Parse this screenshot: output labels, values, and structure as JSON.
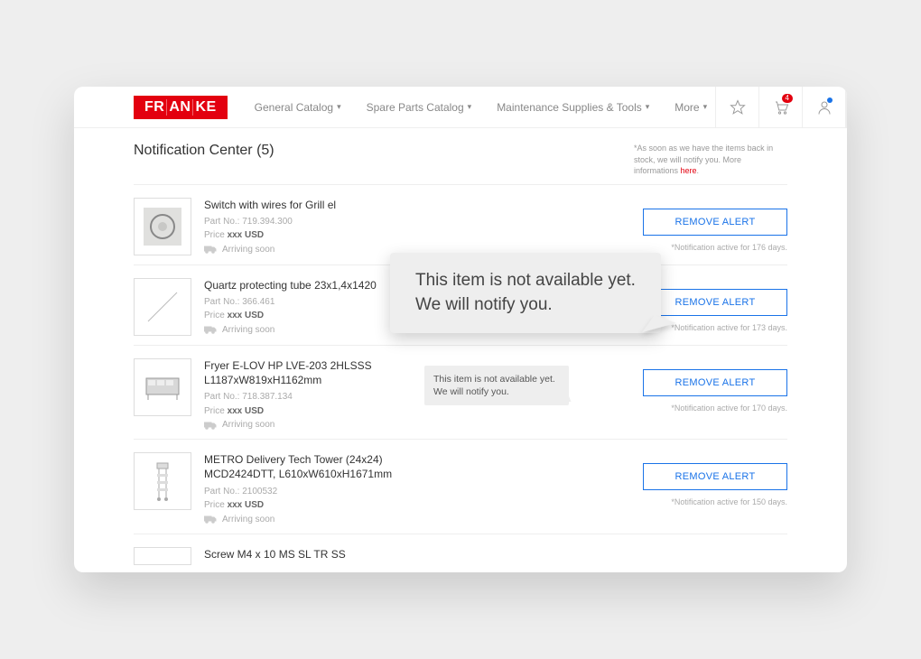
{
  "brand": "FRANKE",
  "nav": {
    "items": [
      {
        "label": "General Catalog"
      },
      {
        "label": "Spare Parts Catalog"
      },
      {
        "label": "Maintenance Supplies & Tools"
      },
      {
        "label": "More"
      }
    ],
    "cart_badge": "4"
  },
  "page": {
    "title": "Notification Center (5)",
    "info_prefix": "*As soon as we have the items back in stock, we will notify you. More informations ",
    "info_link": "here"
  },
  "big_tooltip": "This item is not available yet. We will notify you.",
  "remove_label": "REMOVE ALERT",
  "status_prefix": "*Notification active for ",
  "bubble_text": "This item is not available yet. We will notify you.",
  "part_prefix": "Part No.: ",
  "price_prefix": "Price ",
  "ship_text": "Arriving soon",
  "items": [
    {
      "title": "Switch with wires for Grill el",
      "part": "719.394.300",
      "price": "xxx USD",
      "status_days": "176 days."
    },
    {
      "title": "Quartz protecting tube 23x1,4x1420",
      "part": "366.461",
      "price": "xxx USD",
      "status_days": "173 days."
    },
    {
      "title": "Fryer E-LOV HP LVE-203 2HLSSS L1187xW819xH1162mm",
      "part": "718.387.134",
      "price": "xxx USD",
      "status_days": "170 days."
    },
    {
      "title": "METRO Delivery Tech Tower (24x24) MCD2424DTT, L610xW610xH1671mm",
      "part": "2100532",
      "price": "xxx USD",
      "status_days": "150 days."
    },
    {
      "title": "Screw M4 x 10 MS SL TR SS",
      "part": "",
      "price": "",
      "status_days": ""
    }
  ]
}
